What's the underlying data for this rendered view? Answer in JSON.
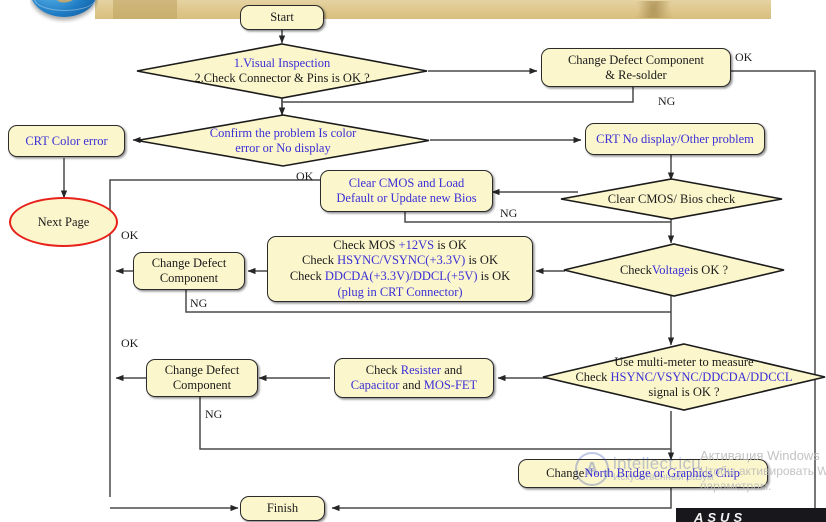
{
  "header": {
    "globe_icon": "globe-icon",
    "band_label": ""
  },
  "flow": {
    "start": "Start",
    "d_visual": {
      "line1": "1.Visual Inspection",
      "line2": "2.Check Connector & Pins is OK ?"
    },
    "change_defect_resolder": {
      "line1": "Change Defect Component",
      "line2": "& Re-solder"
    },
    "d_confirm": {
      "line1": "Confirm the problem Is color",
      "line2": "error or No display"
    },
    "crt_color_error": "CRT Color error",
    "next_page": "Next Page",
    "crt_no_display": "CRT No display/Other problem",
    "d_clear_cmos": "Clear CMOS/ Bios check",
    "clear_cmos_load": {
      "line1": "Clear CMOS and Load",
      "line2": "Default or Update new Bios"
    },
    "d_voltage": {
      "pre": "Check ",
      "kw": "Voltage",
      "post": " is OK ?"
    },
    "check_mos": {
      "l1a": "Check MOS ",
      "l1b": "+12VS",
      "l1c": " is OK",
      "l2a": "Check ",
      "l2b": "HSYNC/VSYNC(+3.3V)",
      "l2c": " is OK",
      "l3a": "Check ",
      "l3b": "DDCDA(+3.3V)/DDCL(+5V)",
      "l3c": " is OK",
      "l4": "(plug in CRT Connector)"
    },
    "change_defect_1": {
      "line1": "Change Defect",
      "line2": "Component"
    },
    "d_multimeter": {
      "line1": "Use multi-meter to measure",
      "l2a": "Check ",
      "l2b": "HSYNC/VSYNC/DDCDA/DDCCL",
      "line3": "signal is OK ?"
    },
    "check_resister": {
      "l1a": "Check ",
      "l1b": "Resister",
      "l1c": " and",
      "l2a": "Capacitor",
      "l2b": " and ",
      "l2c": "MOS-FET"
    },
    "change_defect_2": {
      "line1": "Change Defect",
      "line2": "Component"
    },
    "change_nb": {
      "a": "Change ",
      "b": "North Bridge or Graphics Chip"
    },
    "finish": "Finish"
  },
  "edge_labels": {
    "ok_topright": "OK",
    "ng_resolder": "NG",
    "ok_cmos": "OK",
    "ng_cmos": "NG",
    "ok_voltage_left": "OK",
    "ng_voltage": "NG",
    "ok_signal_left": "OK",
    "ng_signal": "NG"
  },
  "watermarks": {
    "windows": {
      "line1": "Активация Windows",
      "line2": "Чтобы активировать Windows, перейдите в раздел",
      "line3": "параметрам."
    },
    "intellect": {
      "mark": "A",
      "name": "intellect.icu",
      "tagline": "Искусственный разум"
    },
    "brand": "ASUS"
  },
  "colors": {
    "node_fill": "#fbf6cc",
    "node_stroke": "#2b2b2b",
    "accent_blue": "#3b2fd6",
    "ellipse_red": "#e8201a",
    "band": "#dfc98f"
  }
}
